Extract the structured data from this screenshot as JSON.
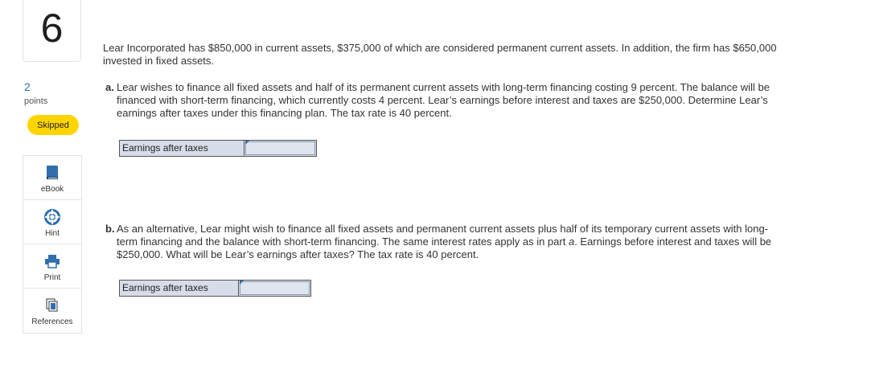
{
  "question": {
    "number": "6",
    "points_value": "2",
    "points_label": "points",
    "status_badge": "Skipped"
  },
  "tools": [
    {
      "label": "eBook",
      "icon": "book-icon"
    },
    {
      "label": "Hint",
      "icon": "lifebuoy-icon"
    },
    {
      "label": "Print",
      "icon": "printer-icon"
    },
    {
      "label": "References",
      "icon": "documents-icon"
    }
  ],
  "colors": {
    "accent": "#2f6fae",
    "badge": "#ffd500",
    "answer_bg": "#d7dde8"
  },
  "problem": {
    "intro": "Lear Incorporated has $850,000 in current assets, $375,000 of which are considered permanent current assets. In addition, the firm has $650,000 invested in fixed assets.",
    "part_a": {
      "letter": "a.",
      "text": "Lear wishes to finance all fixed assets and half of its permanent current assets with long-term financing costing 9 percent. The balance will be financed with short-term financing, which currently costs 4 percent. Lear’s earnings before interest and taxes are $250,000. Determine Lear’s earnings after taxes under this financing plan. The tax rate is 40 percent.",
      "answer_label": "Earnings after taxes",
      "answer_value": ""
    },
    "part_b": {
      "letter": "b.",
      "text_1": "As an alternative, Lear might wish to finance all fixed assets and permanent current assets plus half of its temporary current assets with long-term financing and the balance with short-term financing. The same interest rates apply as in part ",
      "text_italic": "a",
      "text_2": ". Earnings before interest and taxes will be $250,000. What will be Lear’s earnings after taxes? The tax rate is 40 percent.",
      "answer_label": "Earnings after taxes",
      "answer_value": ""
    }
  }
}
